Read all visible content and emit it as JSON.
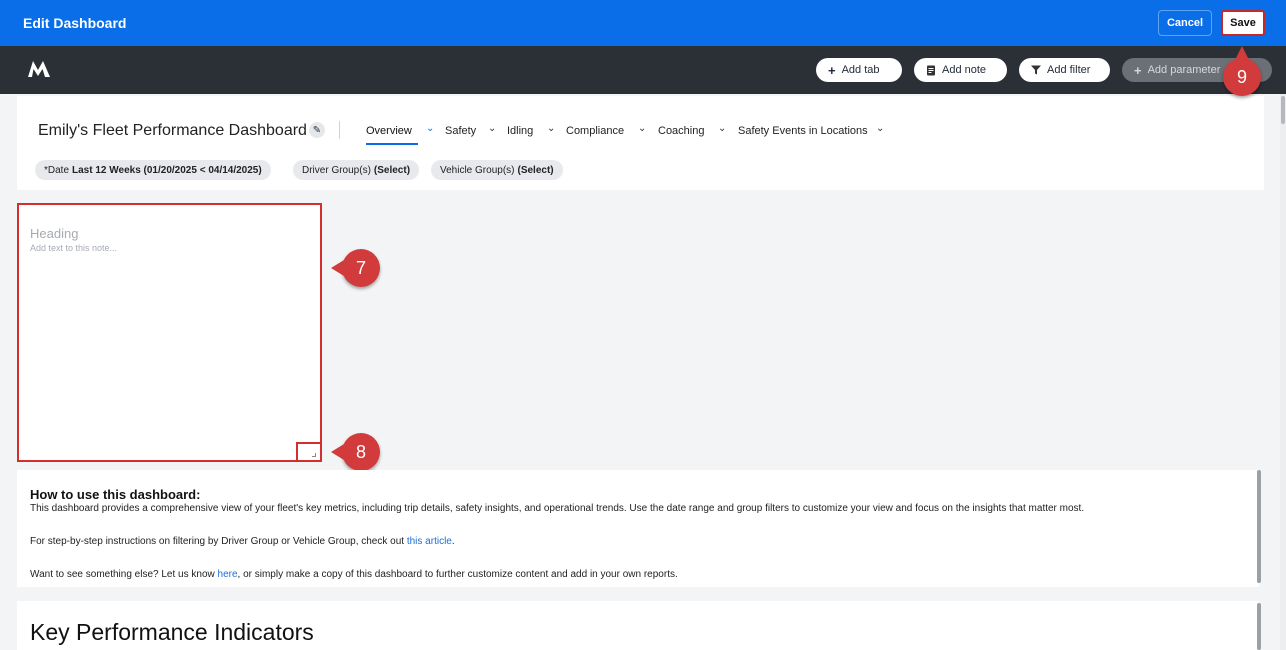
{
  "topbar": {
    "title": "Edit Dashboard",
    "cancel_label": "Cancel",
    "save_label": "Save",
    "color": "#0a6ee8"
  },
  "toolbar": {
    "logo_icon": "m-logo-icon",
    "add_tab": {
      "icon": "plus-icon",
      "label": "Add tab"
    },
    "add_note": {
      "icon": "note-icon",
      "label": "Add note"
    },
    "add_filter": {
      "icon": "filter-icon",
      "label": "Add filter"
    },
    "add_parameter": {
      "icon": "plus-icon",
      "label": "Add parameter",
      "disabled": true
    }
  },
  "dashboard": {
    "title": "Emily's Fleet Performance Dashboard",
    "tabs": [
      {
        "label": "Overview",
        "active": true
      },
      {
        "label": "Safety"
      },
      {
        "label": "Idling"
      },
      {
        "label": "Compliance"
      },
      {
        "label": "Coaching"
      },
      {
        "label": "Safety Events in Locations"
      }
    ],
    "filters": [
      {
        "label": "*Date",
        "value": "Last 12 Weeks (01/20/2025 < 04/14/2025)"
      },
      {
        "label": "Driver Group(s)",
        "value": "(Select)"
      },
      {
        "label": "Vehicle Group(s)",
        "value": "(Select)"
      }
    ]
  },
  "note": {
    "heading_placeholder": "Heading",
    "body_placeholder": "Add text to this note..."
  },
  "markers": {
    "note": "7",
    "resize": "8",
    "save": "9"
  },
  "info": {
    "title": "How to use this dashboard:",
    "line1": "This dashboard provides a comprehensive view of your fleet's key metrics, including trip details, safety insights, and operational trends. Use the date range and group filters to customize your view and focus on the insights that matter most.",
    "line2_prefix": "For step-by-step instructions on filtering by Driver Group or Vehicle Group, check out ",
    "line2_link": "this article",
    "line2_suffix": ".",
    "line3_prefix": "Want to see something else? Let us know ",
    "line3_link": "here",
    "line3_suffix": ", or simply make a copy of this dashboard to further customize content and add in your own reports."
  },
  "kpi": {
    "title": "Key Performance Indicators"
  }
}
